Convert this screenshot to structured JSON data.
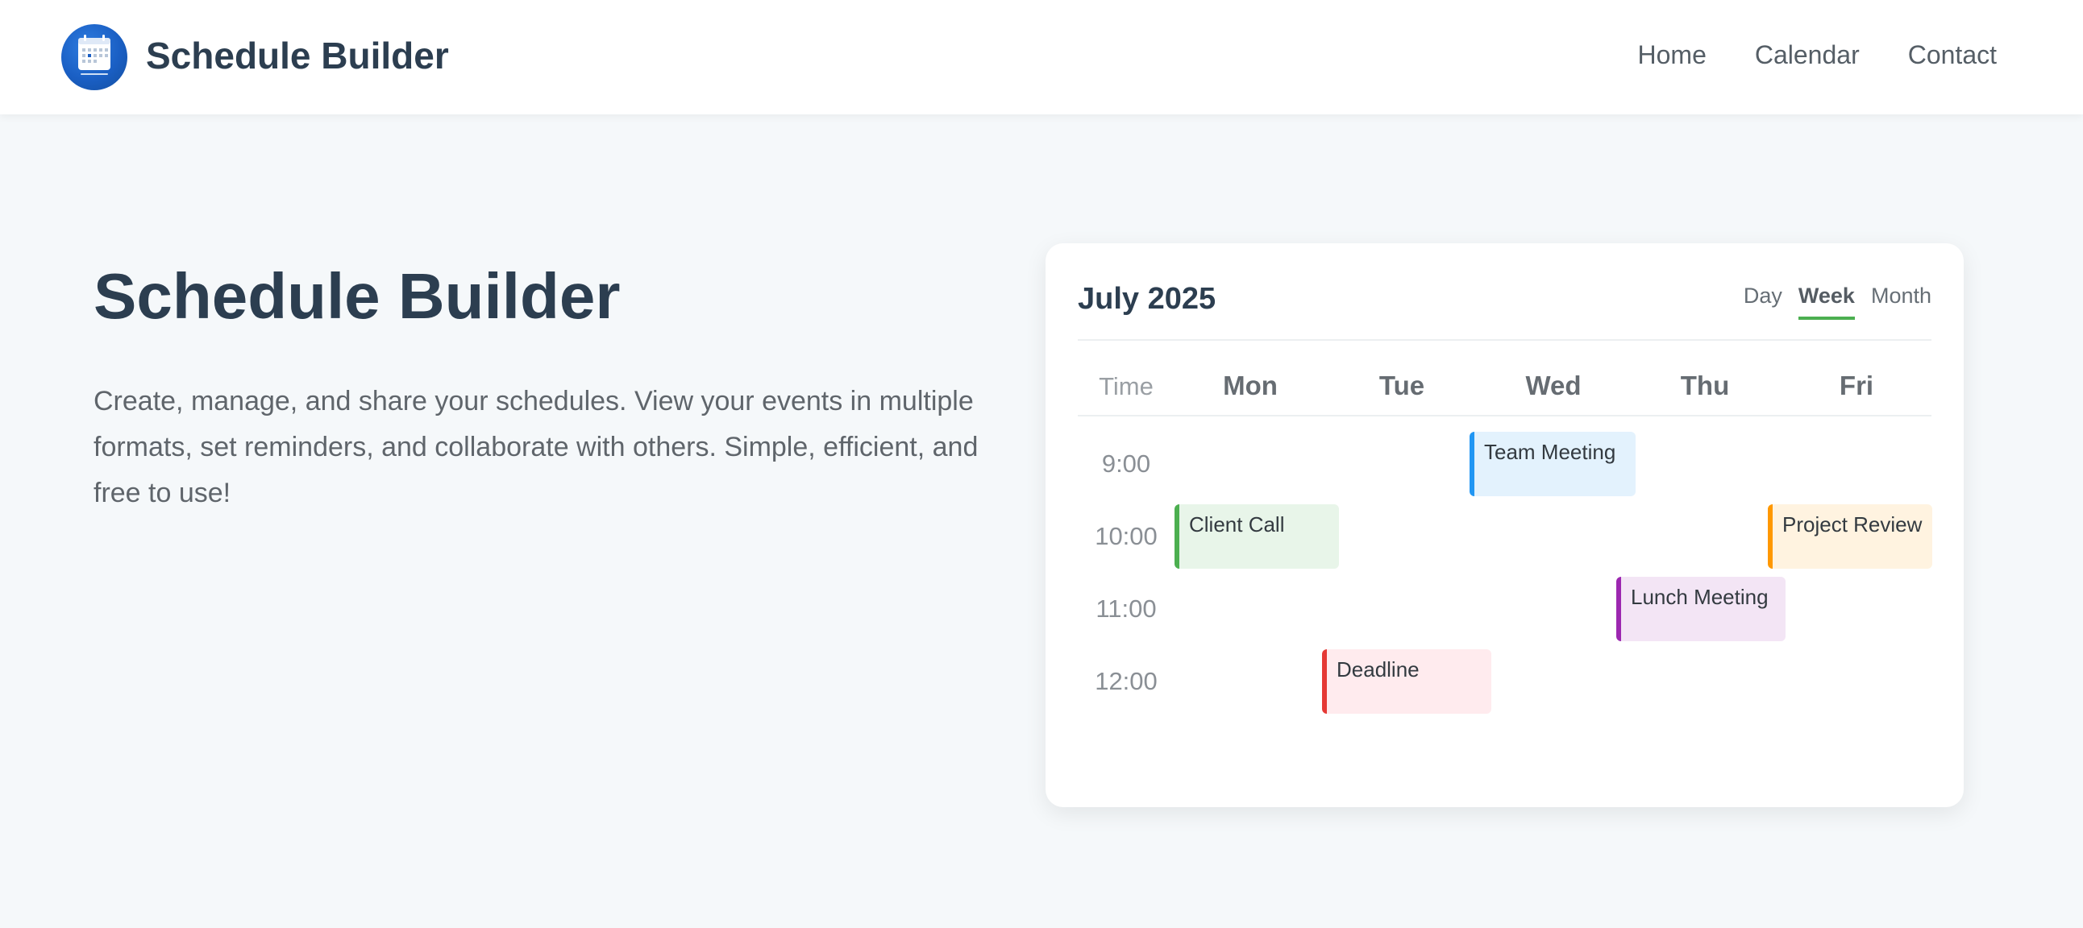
{
  "header": {
    "brand": "Schedule Builder",
    "nav": [
      "Home",
      "Calendar",
      "Contact"
    ]
  },
  "hero": {
    "title": "Schedule Builder",
    "description": "Create, manage, and share your schedules. View your events in multiple formats, set reminders, and collaborate with others. Simple, efficient, and free to use!"
  },
  "calendar": {
    "month": "July 2025",
    "views": [
      "Day",
      "Week",
      "Month"
    ],
    "active_view": "Week",
    "time_header": "Time",
    "days": [
      "Mon",
      "Tue",
      "Wed",
      "Thu",
      "Fri"
    ],
    "times": [
      "9:00",
      "10:00",
      "11:00",
      "12:00"
    ],
    "events": [
      {
        "title": "Team Meeting",
        "day": "Wed",
        "time": "9:00",
        "accent": "#2196f3",
        "bg": "#e3f2fd"
      },
      {
        "title": "Client Call",
        "day": "Mon",
        "time": "10:00",
        "accent": "#4caf50",
        "bg": "#e8f5e9"
      },
      {
        "title": "Project Review",
        "day": "Fri",
        "time": "10:00",
        "accent": "#ff9800",
        "bg": "#fff3e0"
      },
      {
        "title": "Lunch Meeting",
        "day": "Thu",
        "time": "11:00",
        "accent": "#9c27b0",
        "bg": "#f3e5f5"
      },
      {
        "title": "Deadline",
        "day": "Tue",
        "time": "12:00",
        "accent": "#e53935",
        "bg": "#ffebee"
      }
    ]
  }
}
